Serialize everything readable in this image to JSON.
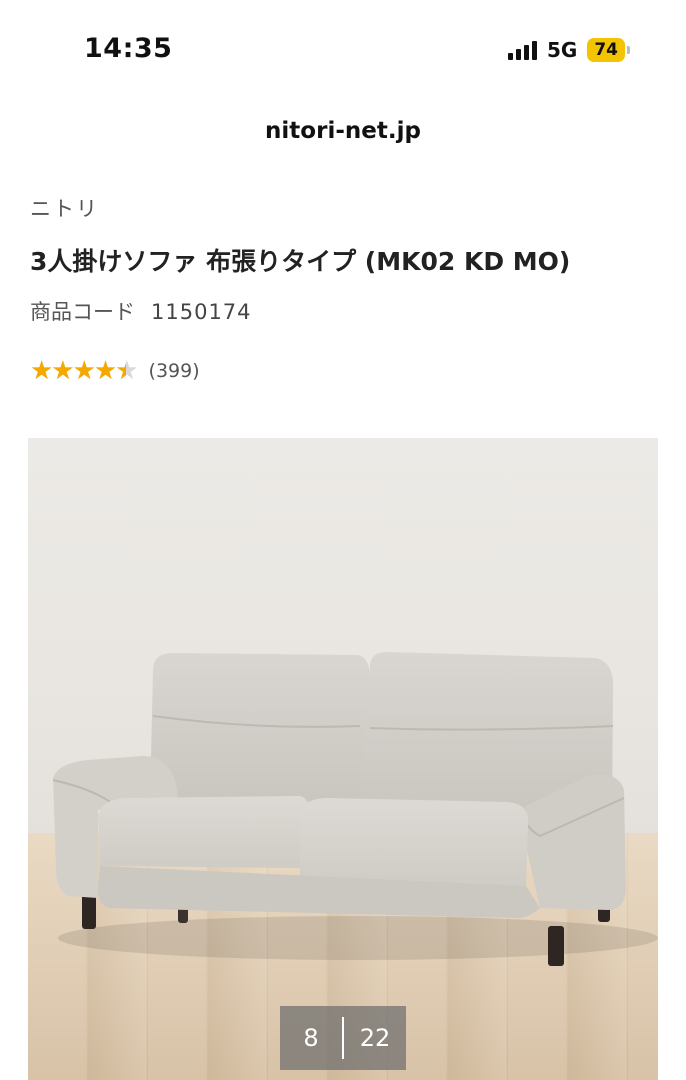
{
  "status_bar": {
    "time": "14:35",
    "network": "5G",
    "battery": "74"
  },
  "browser": {
    "url": "nitori-net.jp"
  },
  "product": {
    "brand": "ニトリ",
    "title": "3人掛けソファ 布張りタイプ (MK02 KD MO)",
    "code_label": "商品コード",
    "code_value": "1150174",
    "rating": {
      "stars": 4.5,
      "max": 5,
      "count_text": "(399)"
    }
  },
  "gallery": {
    "current": "8",
    "total": "22"
  },
  "icons": {
    "signal": "signal-bars-icon",
    "battery": "battery-icon",
    "star": "star-icon"
  },
  "colors": {
    "star": "#f5a800",
    "battery": "#f5c400"
  }
}
